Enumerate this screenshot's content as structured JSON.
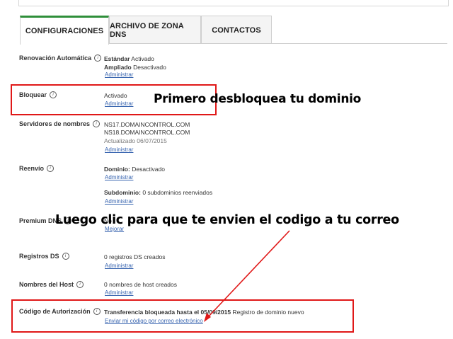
{
  "tabs": [
    {
      "label": "CONFIGURACIONES",
      "active": true
    },
    {
      "label": "ARCHIVO DE ZONA DNS",
      "active": false
    },
    {
      "label": "CONTACTOS",
      "active": false
    }
  ],
  "rows": {
    "renovacion": {
      "label": "Renovación Automática",
      "standard_label": "Estándar",
      "standard_value": "Activado",
      "extended_label": "Ampliado",
      "extended_value": "Desactivado",
      "link": "Administrar"
    },
    "bloquear": {
      "label": "Bloquear",
      "value": "Activado",
      "link": "Administrar"
    },
    "servidores": {
      "label": "Servidores de nombres",
      "ns1": "NS17.DOMAINCONTROL.COM",
      "ns2": "NS18.DOMAINCONTROL.COM",
      "updated": "Actualizado 06/07/2015",
      "link": "Administrar"
    },
    "reenvio": {
      "label": "Reenvío",
      "domain_label": "Dominio:",
      "domain_value": "Desactivado",
      "link1": "Administrar",
      "subdomain_label": "Subdominio:",
      "subdomain_value": "0 subdominios reenviados",
      "link2": "Administrar"
    },
    "premium": {
      "label": "Premium DNS",
      "value": "No",
      "link": "Mejorar"
    },
    "registros": {
      "label": "Registros DS",
      "value": "0 registros DS creados",
      "link": "Administrar"
    },
    "hosts": {
      "label": "Nombres del Host",
      "value": "0 nombres de host creados",
      "link": "Administrar"
    },
    "autorizacion": {
      "label": "Código de Autorización",
      "value_bold": "Transferencia bloqueada hasta el 05/09/2015",
      "value_rest": "Registro de dominio nuevo",
      "link": "Enviar mi código por correo electrónico"
    }
  },
  "annotations": {
    "first": "Primero desbloquea tu dominio",
    "second": "Luego clic para que te envien el codigo a tu correo"
  },
  "colors": {
    "highlight": "#e01818",
    "active_tab": "#2f8f3a",
    "link": "#3a66b0"
  }
}
